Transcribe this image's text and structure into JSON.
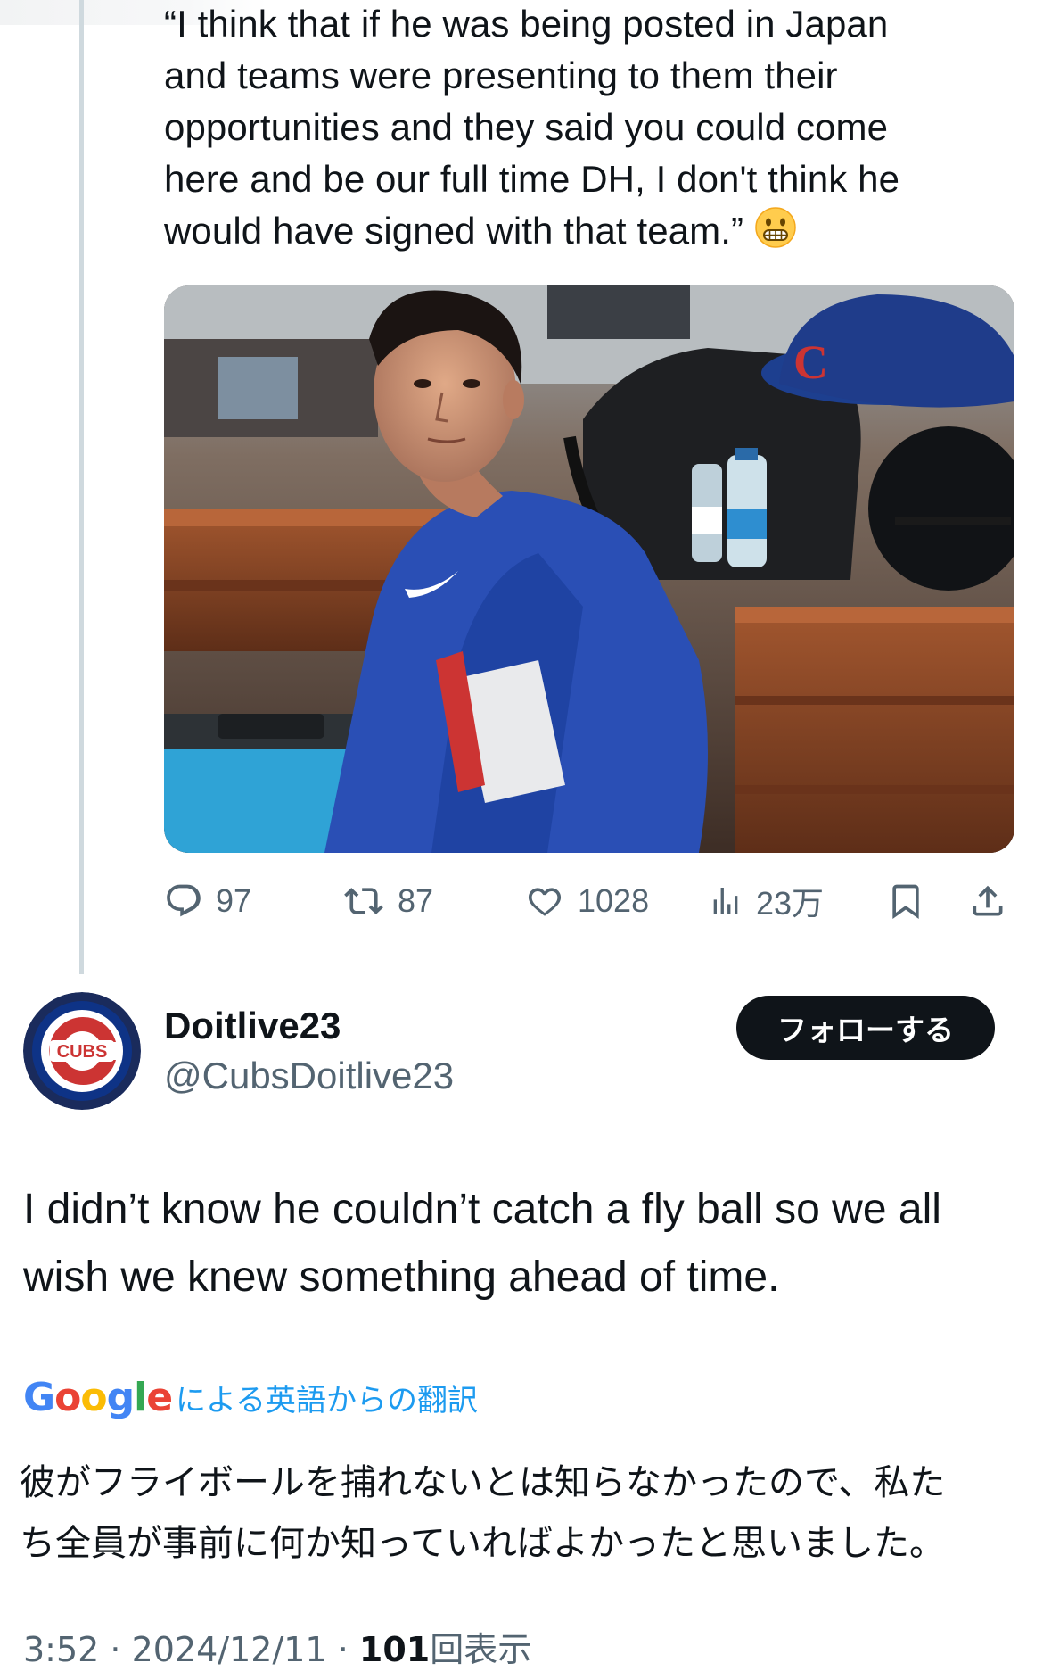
{
  "previous_tweet": {
    "quote_lines": [
      "“I think that if he was being posted in Japan",
      "and teams were presenting to them their",
      "opportunities and they said you could come",
      "here and be our full time DH, I don't think he",
      "would have signed with that team.”"
    ],
    "emoji": "grimacing-face-emoji",
    "actions": {
      "replies": "97",
      "retweets": "87",
      "likes": "1028",
      "views": "23万"
    }
  },
  "reply_tweet": {
    "display_name": "Doitlive23",
    "handle": "@CubsDoitlive23",
    "follow_label": "フォローする",
    "avatar_text": "CUBS",
    "body_lines": [
      "I didn’t know he couldn’t catch a fly ball so we all",
      "wish we knew something ahead of time."
    ],
    "translation": {
      "provider": "Google",
      "label": "による英語からの翻訳",
      "lines": [
        "彼がフライボールを捕れないとは知らなかったので、私た",
        "ち全員が事前に何か知っていればよかったと思いました。"
      ]
    },
    "meta": {
      "time": "3:52",
      "date": "2024/12/11",
      "views_count": "101",
      "views_label": "回表示"
    }
  },
  "photo": {
    "cap_letter": "C",
    "description_icon": "cubs-player-dugout-photo"
  },
  "colors": {
    "text_primary": "#0f1419",
    "text_secondary": "#536471",
    "link_blue": "#1d9bf0",
    "cubs_blue": "#0e3386",
    "cubs_red": "#cc3433"
  }
}
